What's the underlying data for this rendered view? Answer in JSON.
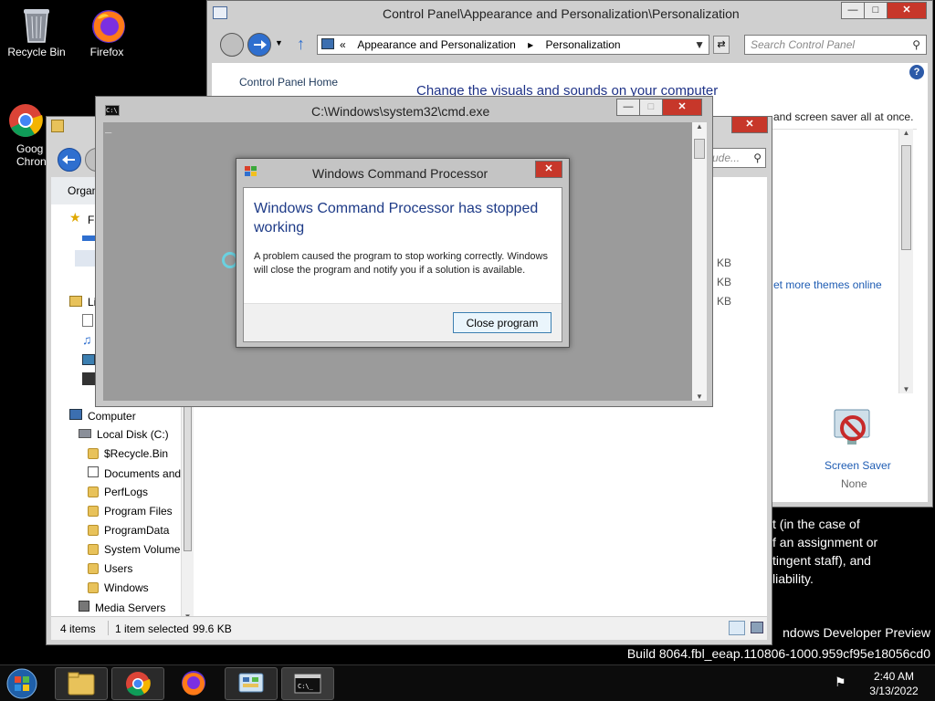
{
  "desktop": {
    "icons": [
      {
        "label": "Recycle Bin",
        "icon": "recycle-bin-icon"
      },
      {
        "label": "Firefox",
        "icon": "firefox-icon"
      },
      {
        "label_line1": "Goog",
        "label_line2": "Chron",
        "icon": "chrome-icon"
      }
    ],
    "text_lines": [
      "t (in the case of",
      "f an assignment or",
      "tingent staff), and",
      "liability."
    ],
    "watermark_line1": "ndows Developer Preview",
    "watermark_line2": "Build 8064.fbl_eeap.110806-1000.959cf95e18056cd0"
  },
  "control_panel": {
    "title": "Control Panel\\Appearance and Personalization\\Personalization",
    "address_prefix": "«",
    "breadcrumbs": [
      "Appearance and Personalization",
      "▸",
      "Personalization"
    ],
    "search_placeholder": "Search Control Panel",
    "home_link": "Control Panel Home",
    "heading": "Change the visuals and sounds on your computer",
    "subtext": "and screen saver all at once.",
    "themes_link": "et more themes online",
    "screen_saver_label": "Screen Saver",
    "screen_saver_value": "None",
    "help": "?"
  },
  "explorer": {
    "organize": "Organ",
    "search_placeholder": "ude...",
    "favorites": "Fa",
    "libraries": "Li",
    "tree": [
      "Computer",
      "Local Disk (C:)",
      "$Recycle.Bin",
      "Documents and",
      "PerfLogs",
      "Program Files",
      "ProgramData",
      "System Volume",
      "Users",
      "Windows",
      "Media Servers"
    ],
    "kb_values": [
      "KB",
      "KB",
      "KB"
    ],
    "status_items": "4 items",
    "status_selected": "1 item selected",
    "status_size": "99.6 KB"
  },
  "cmd": {
    "title": "C:\\Windows\\system32\\cmd.exe",
    "cursor": "_"
  },
  "dialog": {
    "title": "Windows Command Processor",
    "heading": "Windows Command Processor has stopped working",
    "message": "A problem caused the program to stop working correctly. Windows will close the program and notify you if a solution is available.",
    "button": "Close program"
  },
  "taskbar": {
    "time": "2:40 AM",
    "date": "3/13/2022"
  }
}
